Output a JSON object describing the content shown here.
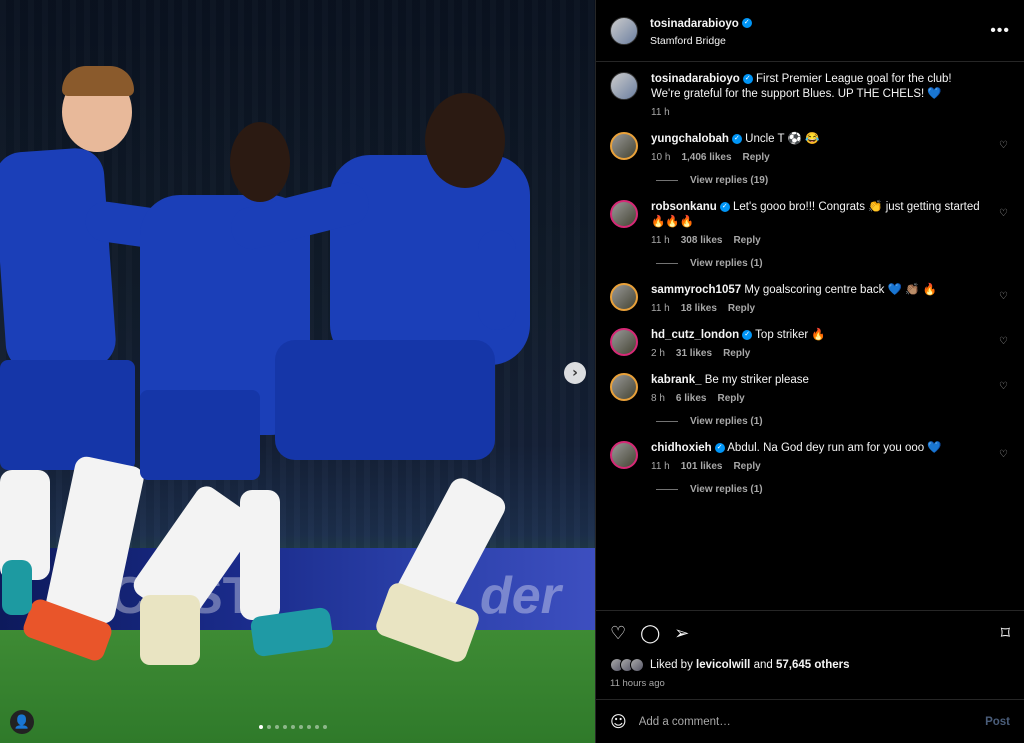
{
  "post": {
    "username": "tosinadarabioyo",
    "location": "Stamford Bridge",
    "caption": "First Premier League goal for the club! We're grateful for the support Blues. UP THE CHELS! 💙",
    "caption_time": "11 h"
  },
  "media": {
    "board_text_1": "COST",
    "board_text_2": "der",
    "dot_count": 9,
    "active_dot": 0
  },
  "comments": [
    {
      "username": "yungchalobah",
      "verified": true,
      "text": "Uncle T ⚽ 😂",
      "time": "10 h",
      "likes": "1,406 likes",
      "reply": "Reply",
      "view_replies": "View replies (19)"
    },
    {
      "username": "robsonkanu",
      "verified": true,
      "text": "Let's gooo bro!!! Congrats 👏 just getting started 🔥🔥🔥",
      "time": "11 h",
      "likes": "308 likes",
      "reply": "Reply",
      "view_replies": "View replies (1)"
    },
    {
      "username": "sammyroch1057",
      "verified": false,
      "text": "My goalscoring centre back 💙 👏🏽 🔥",
      "time": "11 h",
      "likes": "18 likes",
      "reply": "Reply",
      "view_replies": ""
    },
    {
      "username": "hd_cutz_london",
      "verified": true,
      "text": "Top striker 🔥",
      "time": "2 h",
      "likes": "31 likes",
      "reply": "Reply",
      "view_replies": ""
    },
    {
      "username": "kabrank_",
      "verified": false,
      "text": "Be my striker please",
      "time": "8 h",
      "likes": "6 likes",
      "reply": "Reply",
      "view_replies": "View replies (1)"
    },
    {
      "username": "chidhoxieh",
      "verified": true,
      "text": "Abdul. Na God dey run am for you ooo 💙",
      "time": "11 h",
      "likes": "101 likes",
      "reply": "Reply",
      "view_replies": "View replies (1)"
    }
  ],
  "liked_by": {
    "user": "levicolwill",
    "others": "57,645 others",
    "prefix": "Liked by",
    "joiner": "and"
  },
  "post_time": "11 hours ago",
  "add_comment": {
    "placeholder": "Add a comment…",
    "post_label": "Post"
  },
  "icons": {
    "more": "more-horizontal-icon",
    "heart": "heart-icon",
    "comment": "comment-icon",
    "share": "share-icon",
    "save": "bookmark-icon",
    "emoji": "emoji-icon",
    "next": "chevron-right-icon",
    "tag": "user-tag-icon"
  },
  "colors": {
    "verified": "#0095f6",
    "background": "#000000",
    "post_button": "#4a5d7a",
    "kit_blue": "#1b3fb8"
  }
}
